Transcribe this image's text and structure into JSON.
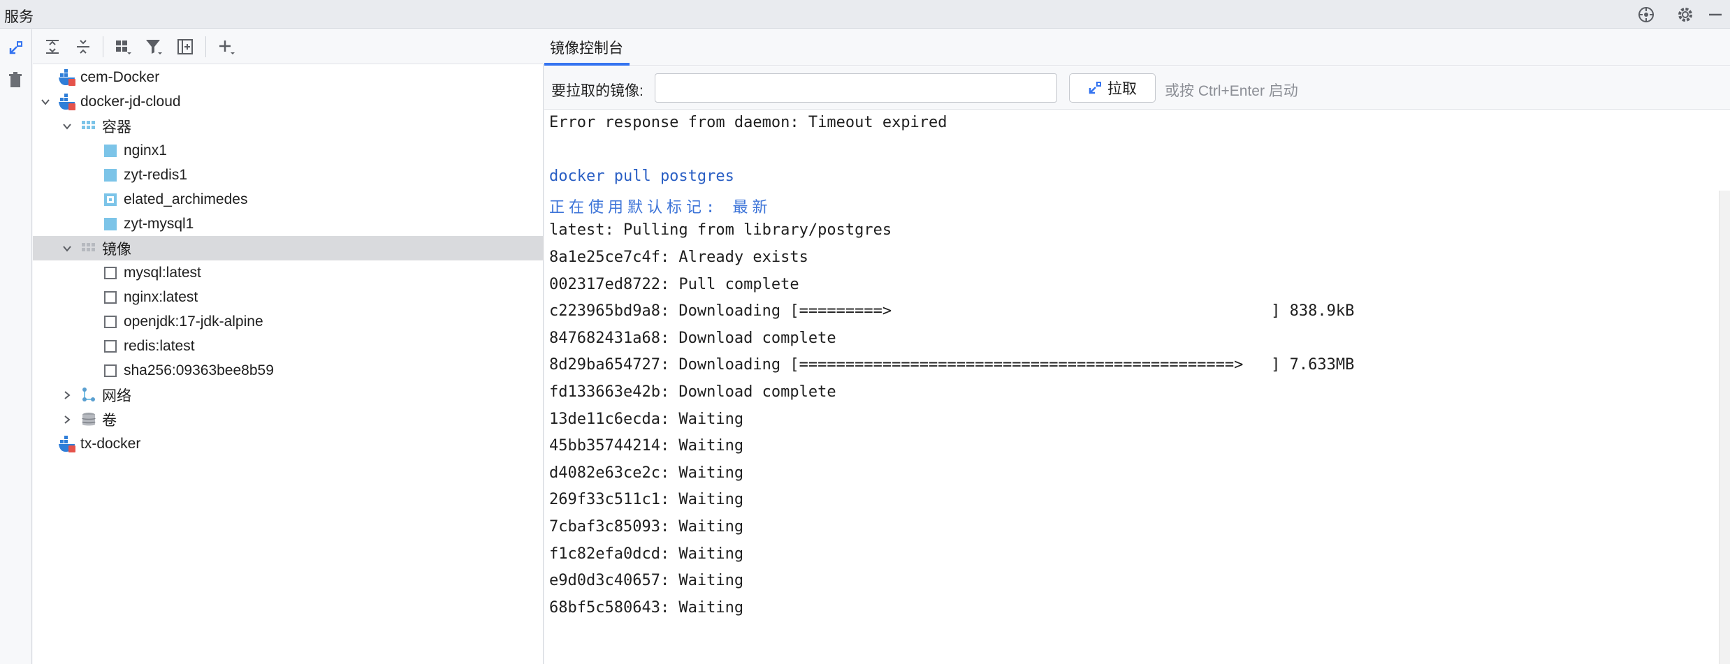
{
  "window": {
    "title": "服务"
  },
  "title_icons": [
    "crosshair-icon",
    "gear-icon",
    "minimize-icon"
  ],
  "left_strip": [
    "expand-icon",
    "trash-icon"
  ],
  "tree_toolbar": [
    "expand-all-icon",
    "collapse-all-icon",
    "group-icon",
    "filter-icon",
    "new-service-icon",
    "add-icon"
  ],
  "tree": {
    "items": [
      {
        "label": "cem-Docker",
        "level": 0,
        "icon": "docker-icon",
        "expanded": null
      },
      {
        "label": "docker-jd-cloud",
        "level": 0,
        "icon": "docker-icon",
        "expanded": true
      },
      {
        "label": "容器",
        "level": 1,
        "icon": "containers-icon",
        "expanded": true
      },
      {
        "label": "nginx1",
        "level": 2,
        "icon": "container-running-icon",
        "expanded": null
      },
      {
        "label": "zyt-redis1",
        "level": 2,
        "icon": "container-running-icon",
        "expanded": null
      },
      {
        "label": "elated_archimedes",
        "level": 2,
        "icon": "container-stopped-icon",
        "expanded": null
      },
      {
        "label": "zyt-mysql1",
        "level": 2,
        "icon": "container-running-icon",
        "expanded": null
      },
      {
        "label": "镜像",
        "level": 1,
        "icon": "images-icon",
        "expanded": true,
        "selected": true
      },
      {
        "label": "mysql:latest",
        "level": 2,
        "icon": "image-icon",
        "expanded": null
      },
      {
        "label": "nginx:latest",
        "level": 2,
        "icon": "image-icon",
        "expanded": null
      },
      {
        "label": "openjdk:17-jdk-alpine",
        "level": 2,
        "icon": "image-icon",
        "expanded": null
      },
      {
        "label": "redis:latest",
        "level": 2,
        "icon": "image-icon",
        "expanded": null
      },
      {
        "label": "sha256:09363bee8b59",
        "level": 2,
        "icon": "image-icon",
        "expanded": null
      },
      {
        "label": "网络",
        "level": 1,
        "icon": "network-icon",
        "expanded": false
      },
      {
        "label": "卷",
        "level": 1,
        "icon": "volume-icon",
        "expanded": false
      },
      {
        "label": "tx-docker",
        "level": 0,
        "icon": "docker-icon",
        "expanded": null
      }
    ]
  },
  "tab": {
    "label": "镜像控制台"
  },
  "pull": {
    "label": "要拉取的镜像:",
    "value": "",
    "button_label": "拉取",
    "hint": "或按 Ctrl+Enter 启动"
  },
  "console": {
    "lines": [
      {
        "text": "Error response from daemon: Timeout expired",
        "kind": "normal"
      },
      {
        "text": "",
        "kind": "normal"
      },
      {
        "text": "docker pull postgres",
        "kind": "cmd"
      },
      {
        "text": "正在使用默认标记: 最新",
        "kind": "info"
      },
      {
        "text": "latest: Pulling from library/postgres",
        "kind": "normal"
      },
      {
        "text": "8a1e25ce7c4f: Already exists",
        "kind": "normal"
      },
      {
        "text": "002317ed8722: Pull complete",
        "kind": "normal"
      },
      {
        "text": "c223965bd9a8: Downloading [=========>                                         ] 838.9kB",
        "kind": "normal"
      },
      {
        "text": "847682431a68: Download complete",
        "kind": "normal"
      },
      {
        "text": "8d29ba654727: Downloading [===============================================>   ] 7.633MB",
        "kind": "normal"
      },
      {
        "text": "fd133663e42b: Download complete",
        "kind": "normal"
      },
      {
        "text": "13de11c6ecda: Waiting",
        "kind": "normal"
      },
      {
        "text": "45bb35744214: Waiting",
        "kind": "normal"
      },
      {
        "text": "d4082e63ce2c: Waiting",
        "kind": "normal"
      },
      {
        "text": "269f33c511c1: Waiting",
        "kind": "normal"
      },
      {
        "text": "7cbaf3c85093: Waiting",
        "kind": "normal"
      },
      {
        "text": "f1c82efa0dcd: Waiting",
        "kind": "normal"
      },
      {
        "text": "e9d0d3c40657: Waiting",
        "kind": "normal"
      },
      {
        "text": "68bf5c580643: Waiting",
        "kind": "normal"
      }
    ]
  },
  "colors": {
    "accent": "#3574f0",
    "command": "#2a5fc4",
    "container": "#7cc4e8",
    "docker": "#2f7ed8",
    "selection": "#d9dadd"
  }
}
